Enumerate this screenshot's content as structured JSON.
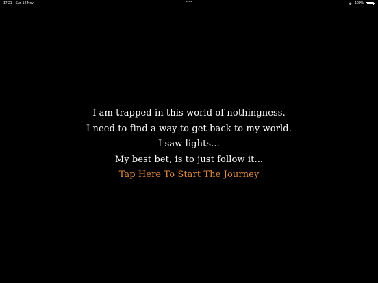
{
  "status_bar": {
    "time": "17:21",
    "date": "Sun 12 Nov",
    "battery": "100%",
    "battery_level": 1.0
  },
  "intro": {
    "lines": [
      "I am trapped in this world of nothingness.",
      "I need to find a way to get back to my world.",
      "I saw lights...",
      "My best bet, is to just follow it..."
    ],
    "start_label": "Tap Here To Start The Journey"
  },
  "colors": {
    "background": "#000000",
    "text": "#ffffff",
    "accent": "#e08a3c"
  },
  "icons": [
    "wifi-icon",
    "battery-icon",
    "multitasking-dots-icon"
  ]
}
